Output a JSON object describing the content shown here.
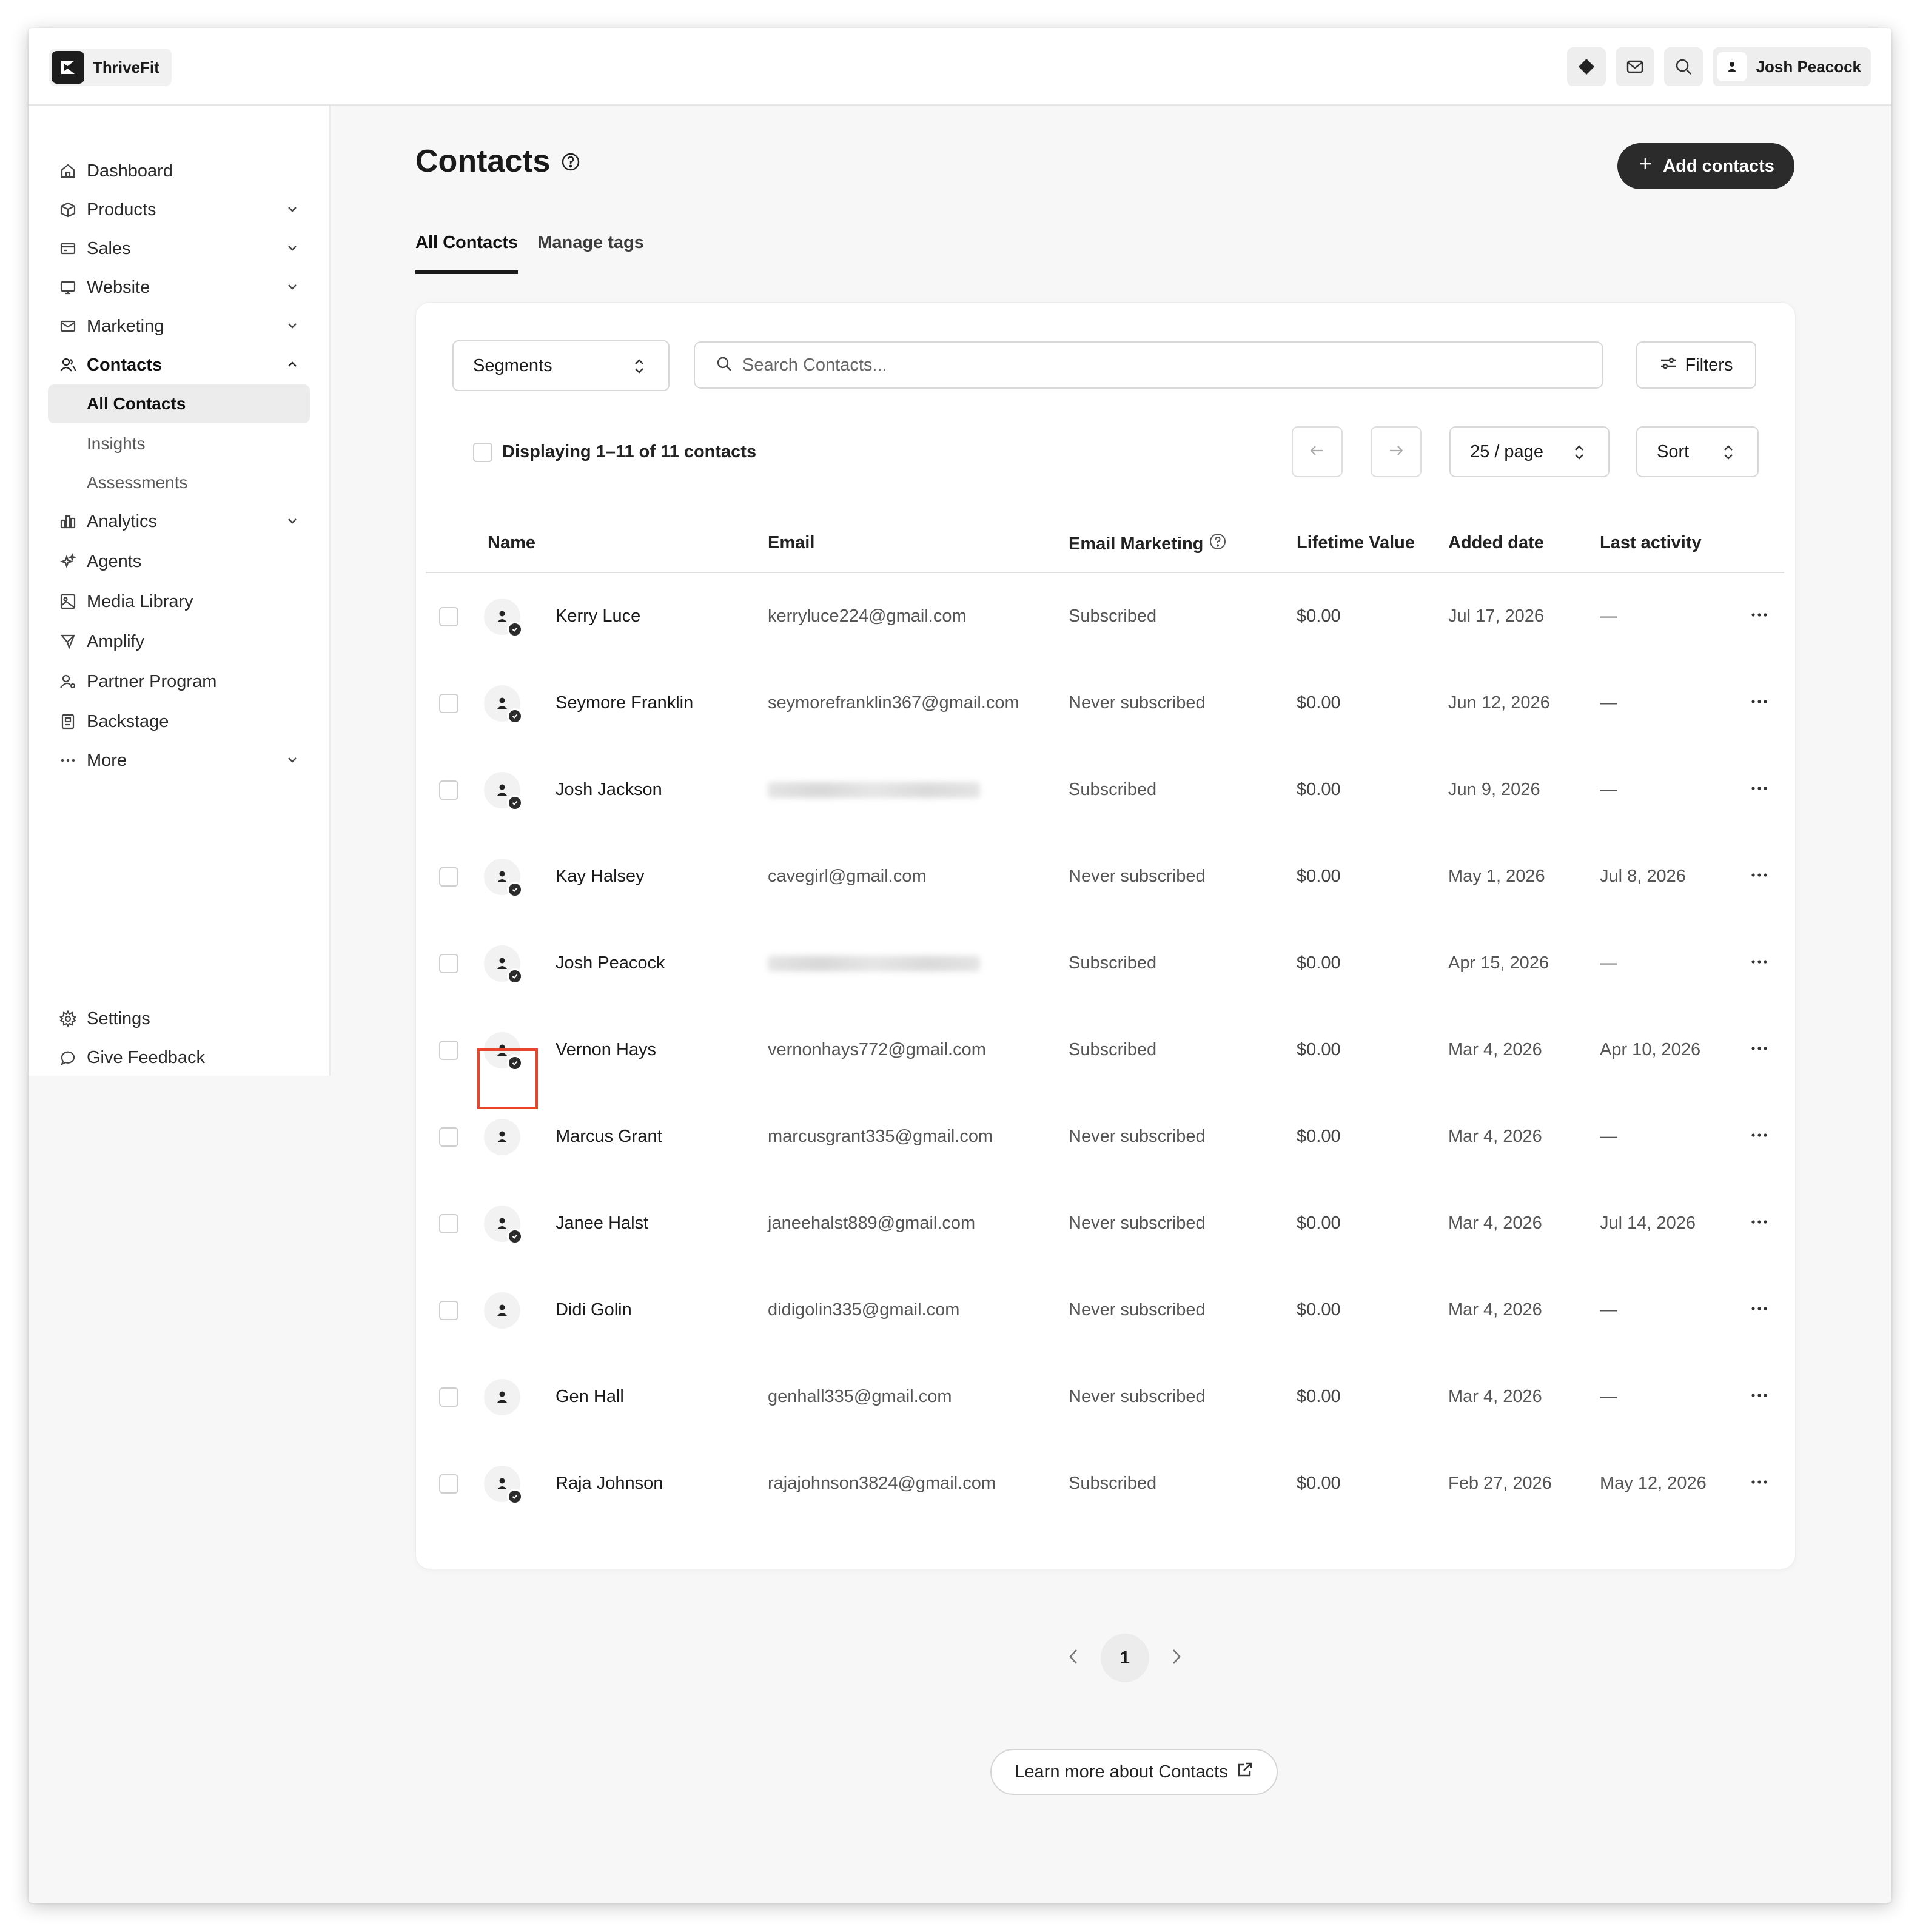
{
  "app": {
    "name": "ThriveFit"
  },
  "topbar": {
    "user_name": "Josh Peacock"
  },
  "sidebar": {
    "items": [
      {
        "label": "Dashboard"
      },
      {
        "label": "Products"
      },
      {
        "label": "Sales"
      },
      {
        "label": "Website"
      },
      {
        "label": "Marketing"
      },
      {
        "label": "Contacts"
      },
      {
        "label": "Analytics"
      },
      {
        "label": "Agents"
      },
      {
        "label": "Media Library"
      },
      {
        "label": "Amplify"
      },
      {
        "label": "Partner Program"
      },
      {
        "label": "Backstage"
      },
      {
        "label": "More"
      }
    ],
    "contacts_sub": [
      "All Contacts",
      "Insights",
      "Assessments"
    ],
    "footer": {
      "settings": "Settings",
      "feedback": "Give Feedback"
    }
  },
  "page": {
    "title": "Contacts",
    "add_button": "Add contacts",
    "tabs": [
      "All Contacts",
      "Manage tags"
    ]
  },
  "toolbar": {
    "segments": "Segments",
    "search_placeholder": "Search Contacts...",
    "filters": "Filters",
    "display_text": "Displaying 1–11 of 11 contacts",
    "per_page": "25 / page",
    "sort": "Sort"
  },
  "table": {
    "headers": [
      "Name",
      "Email",
      "Email Marketing",
      "Lifetime Value",
      "Added date",
      "Last activity"
    ],
    "rows": [
      {
        "name": "Kerry Luce",
        "email": "kerryluce224@gmail.com",
        "marketing": "Subscribed",
        "value": "$0.00",
        "added": "Jul 17, 2026",
        "activity": "—",
        "verified": true
      },
      {
        "name": "Seymore Franklin",
        "email": "seymorefranklin367@gmail.com",
        "marketing": "Never subscribed",
        "value": "$0.00",
        "added": "Jun 12, 2026",
        "activity": "—",
        "verified": true
      },
      {
        "name": "Josh Jackson",
        "email": "",
        "marketing": "Subscribed",
        "value": "$0.00",
        "added": "Jun 9, 2026",
        "activity": "—",
        "verified": true,
        "blurred": true
      },
      {
        "name": "Kay Halsey",
        "email": "cavegirl@gmail.com",
        "marketing": "Never subscribed",
        "value": "$0.00",
        "added": "May 1, 2026",
        "activity": "Jul 8, 2026",
        "verified": true
      },
      {
        "name": "Josh Peacock",
        "email": "",
        "marketing": "Subscribed",
        "value": "$0.00",
        "added": "Apr 15, 2026",
        "activity": "—",
        "verified": true,
        "blurred": true
      },
      {
        "name": "Vernon Hays",
        "email": "vernonhays772@gmail.com",
        "marketing": "Subscribed",
        "value": "$0.00",
        "added": "Mar 4, 2026",
        "activity": "Apr 10, 2026",
        "verified": true
      },
      {
        "name": "Marcus Grant",
        "email": "marcusgrant335@gmail.com",
        "marketing": "Never subscribed",
        "value": "$0.00",
        "added": "Mar 4, 2026",
        "activity": "—",
        "verified": false
      },
      {
        "name": "Janee Halst",
        "email": "janeehalst889@gmail.com",
        "marketing": "Never subscribed",
        "value": "$0.00",
        "added": "Mar 4, 2026",
        "activity": "Jul 14, 2026",
        "verified": true
      },
      {
        "name": "Didi Golin",
        "email": "didigolin335@gmail.com",
        "marketing": "Never subscribed",
        "value": "$0.00",
        "added": "Mar 4, 2026",
        "activity": "—",
        "verified": false
      },
      {
        "name": "Gen Hall",
        "email": "genhall335@gmail.com",
        "marketing": "Never subscribed",
        "value": "$0.00",
        "added": "Mar 4, 2026",
        "activity": "—",
        "verified": false
      },
      {
        "name": "Raja Johnson",
        "email": "rajajohnson3824@gmail.com",
        "marketing": "Subscribed",
        "value": "$0.00",
        "added": "Feb 27, 2026",
        "activity": "May 12, 2026",
        "verified": true
      }
    ]
  },
  "pagination": {
    "current": "1"
  },
  "learn_more": "Learn more about Contacts"
}
